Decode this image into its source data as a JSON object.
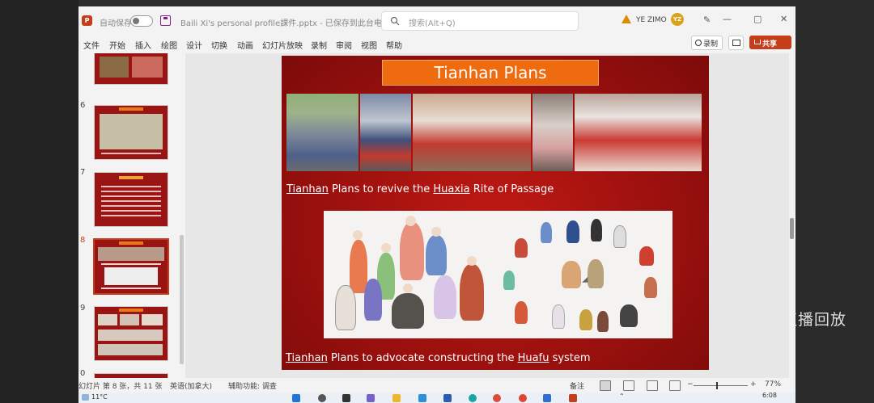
{
  "app": {
    "autosave_label": "自动保存",
    "doc_title": "Baili Xi's personal profile課件.pptx - 已保存到此台电脑",
    "search_placeholder": "搜索(Alt+Q)",
    "user_name": "YE ZIMO",
    "user_initials": "YZ",
    "logo_letter": "P"
  },
  "ribbon": {
    "tabs": [
      "文件",
      "开始",
      "插入",
      "绘图",
      "设计",
      "切换",
      "动画",
      "幻灯片放映",
      "录制",
      "审阅",
      "视图",
      "帮助"
    ],
    "record_label": "录制",
    "share_label": "共享"
  },
  "thumbnails": [
    {
      "num": "6"
    },
    {
      "num": "7"
    },
    {
      "num": "8"
    },
    {
      "num": "9"
    },
    {
      "num": "0"
    }
  ],
  "slide": {
    "title": "Tianhan Plans",
    "caption1": {
      "a": "Tianhan",
      "b": " Plans to revive the ",
      "c": "Huaxia",
      "d": " Rite of Passage"
    },
    "caption2": {
      "a": "Tianhan",
      "b": " Plans to advocate constructing the ",
      "c": "Huafu",
      "d": " system"
    }
  },
  "statusbar": {
    "slide_count": "幻灯片 第 8 张，共 11 张",
    "language": "英语(加拿大)",
    "accessibility": "辅助功能: 调查",
    "notes": "备注",
    "zoom": "77%"
  },
  "taskbar": {
    "weather": "11°C",
    "time": "6:08"
  },
  "overlay": {
    "watermark": "直播回放"
  },
  "colors": {
    "accent": "#c43e1c",
    "slide_red": "#a3120f",
    "title_orange": "#ef6b0f"
  }
}
